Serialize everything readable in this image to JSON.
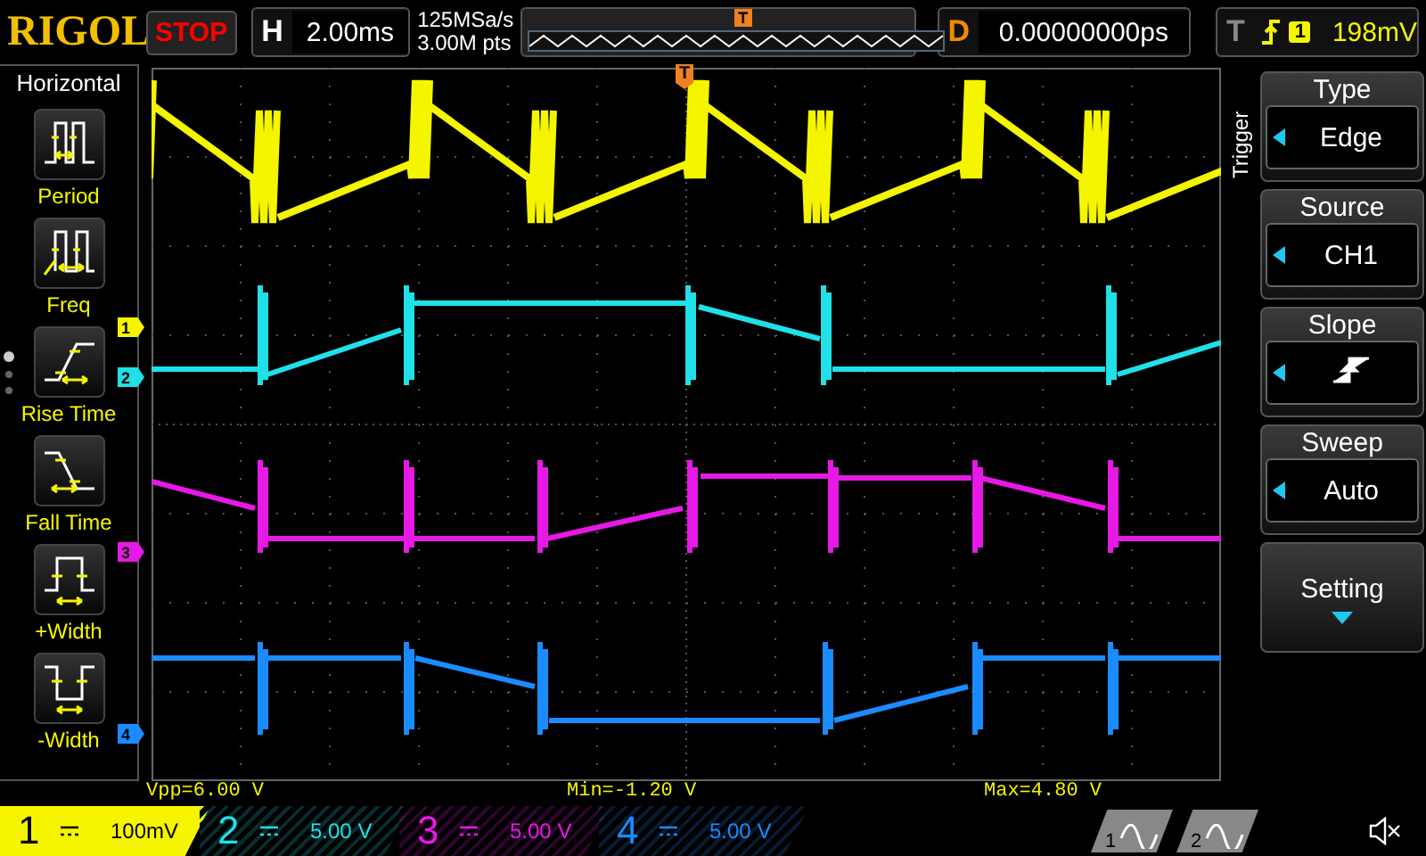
{
  "header": {
    "logo": "RIGOL",
    "run_state": "STOP",
    "timebase": {
      "label": "H",
      "value": "2.00ms"
    },
    "sample_rate": "125MSa/s",
    "memory_depth": "3.00M pts",
    "memory_marker": "T",
    "delay": {
      "label": "D",
      "value": "0.00000000ps"
    },
    "trigger": {
      "label": "T",
      "source": "1",
      "level": "198mV"
    }
  },
  "left_menu": {
    "title": "Horizontal",
    "items": [
      {
        "label": "Period",
        "kind": "period"
      },
      {
        "label": "Freq",
        "kind": "freq"
      },
      {
        "label": "Rise Time",
        "kind": "rise"
      },
      {
        "label": "Fall Time",
        "kind": "fall"
      },
      {
        "label": "+Width",
        "kind": "pwidth"
      },
      {
        "label": "-Width",
        "kind": "nwidth"
      }
    ]
  },
  "trigger_position_marker": "T",
  "right_menu": {
    "title": "Trigger",
    "items": [
      {
        "label": "Type",
        "kind": "value",
        "value": "Edge"
      },
      {
        "label": "Source",
        "kind": "value",
        "value": "CH1"
      },
      {
        "label": "Slope",
        "kind": "slope"
      },
      {
        "label": "Sweep",
        "kind": "value",
        "value": "Auto"
      },
      {
        "label": "Setting",
        "kind": "submenu"
      }
    ]
  },
  "measurements": [
    "Vpp=6.00 V",
    "Min=-1.20 V",
    "Max=4.80 V"
  ],
  "channels": [
    {
      "number": "1",
      "marker": "1",
      "scale": "100mV",
      "selected": true,
      "color": "#f5f500"
    },
    {
      "number": "2",
      "marker": "2",
      "scale": "5.00 V",
      "selected": false,
      "color": "#20e0e8"
    },
    {
      "number": "3",
      "marker": "3",
      "scale": "5.00 V",
      "selected": false,
      "color": "#e619e6"
    },
    {
      "number": "4",
      "marker": "4",
      "scale": "5.00 V",
      "selected": false,
      "color": "#1a8cff"
    }
  ],
  "generators": [
    {
      "label": "1"
    },
    {
      "label": "2"
    }
  ]
}
